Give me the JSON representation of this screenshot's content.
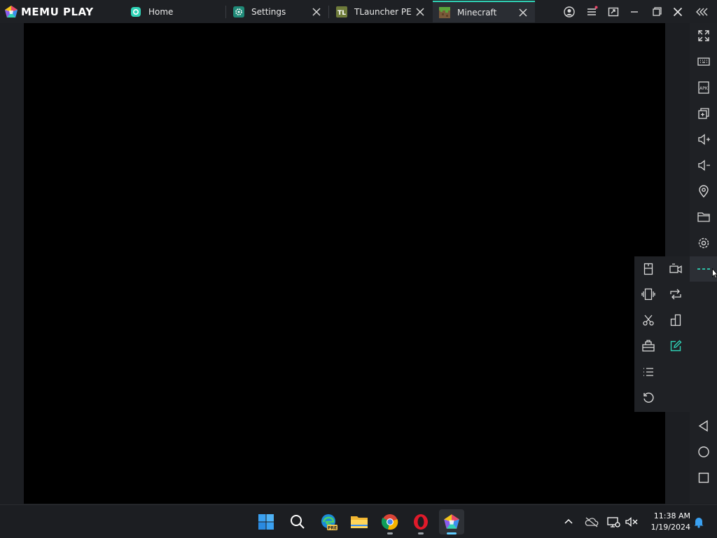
{
  "app": {
    "brand_text": "MEMU PLAY"
  },
  "tabs": [
    {
      "label": "Home",
      "icon": "memu-home-icon",
      "closable": false
    },
    {
      "label": "Settings",
      "icon": "gear-icon",
      "closable": true
    },
    {
      "label": "TLauncher PE",
      "icon": "tlauncher-icon",
      "icon_text": "TL",
      "closable": true
    },
    {
      "label": "Minecraft",
      "icon": "minecraft-grass-icon",
      "closable": true,
      "active": true
    }
  ],
  "window_controls": [
    "account-icon",
    "menu-icon",
    "multi-instance-icon",
    "minimize-icon",
    "maximize-icon",
    "close-icon",
    "collapse-sidebar-icon"
  ],
  "right_toolbar": [
    "fullscreen-icon",
    "keyboard-mapping-icon",
    "apk-install-icon",
    "add-instance-icon",
    "volume-up-icon",
    "volume-down-icon",
    "location-icon",
    "shared-folder-icon",
    "settings-icon",
    "more-icon",
    "back-icon",
    "home-icon",
    "recent-apps-icon"
  ],
  "popup_menu": [
    "screenshot-icon",
    "record-icon",
    "shake-icon",
    "rotate-icon",
    "cut-icon",
    "multi-window-icon",
    "toolbox-icon",
    "edit-icon",
    "operation-record-icon",
    "reboot-icon"
  ],
  "taskbar": {
    "apps": [
      "windows-start-icon",
      "search-icon",
      "edge-preview-icon",
      "file-explorer-icon",
      "chrome-icon",
      "opera-icon",
      "memu-icon"
    ],
    "edge_badge": "PRE",
    "tray": [
      "chevron-up-icon",
      "onedrive-icon",
      "network-icon",
      "volume-muted-icon"
    ],
    "time": "11:38 AM",
    "date": "1/19/2024",
    "notification": "bell-icon"
  },
  "colors": {
    "accent": "#2fd2b6",
    "titlebar": "#1e2024",
    "screen": "#000000",
    "taskbar_indicator": "#60cdff"
  }
}
